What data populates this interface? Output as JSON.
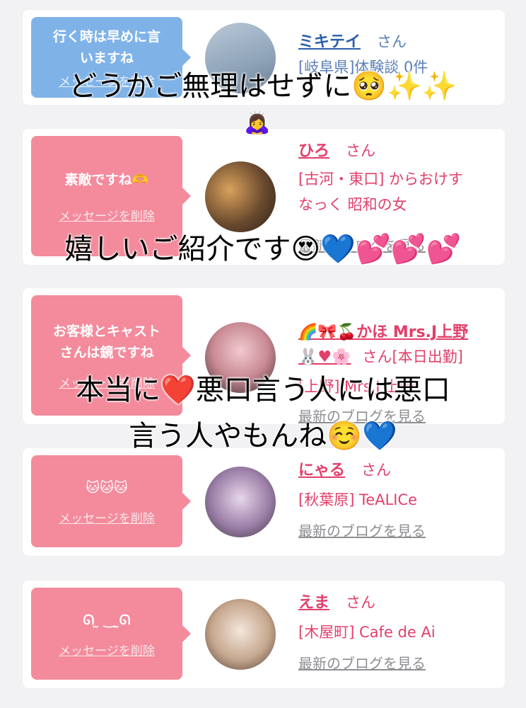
{
  "cards": [
    {
      "message": "行く時は早めに言\nいますね",
      "delete_label": "メッセージを削除",
      "name": "ミキテイ",
      "san": "さん",
      "location": "[岐阜県]体験談 0件",
      "blog": ""
    },
    {
      "message": "素敵ですね🫶",
      "delete_label": "メッセージを削除",
      "name": "ひろ",
      "san": "さん",
      "location": "[古河・東口] からおけす\nなっく 昭和の女",
      "blog": "最新のブログを見る"
    },
    {
      "message": "お客様とキャスト\nさんは鏡ですね",
      "delete_label": "メッセージを削除",
      "name": "🌈🎀🍒かほ Mrs.J上野\n🐰♥🌸",
      "san": "さん[本日出勤]",
      "location": "[上野] Mrs.J 上野",
      "blog": "最新のブログを見る"
    },
    {
      "message": "🐱🐱🐱",
      "delete_label": "メッセージを削除",
      "name": "にゃる",
      "san": "さん",
      "location": "[秋葉原] TeALICe",
      "blog": "最新のブログを見る"
    },
    {
      "message": "ᘏ ̫ ‿ ̫ᘏ",
      "delete_label": "メッセージを削除",
      "name": "えま",
      "san": "さん",
      "location": "[木屋町] Cafe de Ai",
      "blog": "最新のブログを見る"
    }
  ],
  "overlay_text": {
    "line1": "どうかご無理はせずに🥺✨✨",
    "line1b": "🙇‍♀️",
    "line2": "嬉しいご紹介です😍💙💕💕💕",
    "line3": "本当に❤️悪口言う人には悪口",
    "line4": "言う人やもんね☺️💙"
  },
  "colors": {
    "pink_bubble": "#f38b9c",
    "blue_bubble": "#7fb3e8",
    "pink_text": "#e23f6a",
    "blue_text": "#2a5fa8"
  }
}
